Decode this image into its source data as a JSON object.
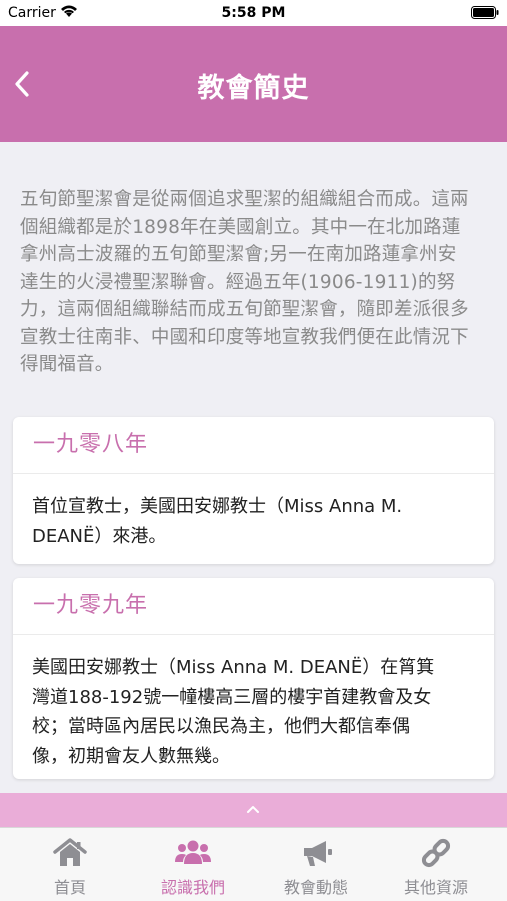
{
  "status_bar": {
    "carrier": "Carrier",
    "time": "5:58 PM"
  },
  "nav": {
    "title": "教會簡史"
  },
  "intro": {
    "lines": [
      "五旬節聖潔會是從兩個追求聖潔的組織組合而成。這兩",
      "個組織都是於1898年在美國創立。其中一在北加路蓮",
      "拿州高士波羅的五旬節聖潔會;另一在南加路蓮拿州安",
      "達生的火浸禮聖潔聯會。經過五年(1906-1911)的努",
      "力，這兩個組織聯結而成五旬節聖潔會，隨即差派很多",
      "宣教士往南非、中國和印度等地宣教我們便在此情況下",
      "得聞福音。"
    ]
  },
  "timeline": [
    {
      "year": "一九零八年",
      "lines": [
        "首位宣教士，美國田安娜教士（Miss Anna M.",
        "DEANË）來港。"
      ]
    },
    {
      "year": "一九零九年",
      "lines": [
        "美國田安娜教士（Miss Anna M. DEANË）在筲箕",
        "灣道188-192號一幢樓高三層的樓宇首建教會及女",
        "校；當時區內居民以漁民為主，他們大都信奉偶",
        "像，初期會友人數無幾。"
      ]
    }
  ],
  "tabs": [
    {
      "label": "首頁",
      "icon": "home-icon"
    },
    {
      "label": "認識我們",
      "icon": "group-icon"
    },
    {
      "label": "教會動態",
      "icon": "megaphone-icon"
    },
    {
      "label": "其他資源",
      "icon": "link-icon"
    }
  ],
  "active_tab": "認識我們",
  "colors": {
    "accent": "#c86fad",
    "strip": "#eaadd8",
    "tab_inactive": "#8e8e93"
  }
}
